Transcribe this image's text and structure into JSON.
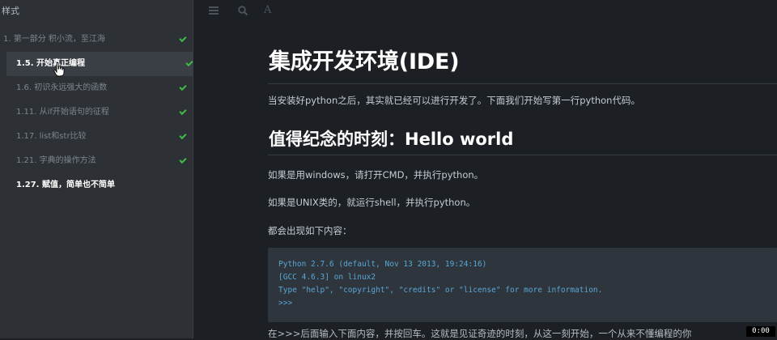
{
  "sidebar": {
    "header": "样式",
    "items": [
      {
        "label": "1. 第一部分 积小流，至江海",
        "checked": true
      },
      {
        "label": "1.5. 开始真正编程",
        "checked": true
      },
      {
        "label": "1.6. 初识永远强大的函数",
        "checked": true
      },
      {
        "label": "1.11. 从if开始语句的征程",
        "checked": true
      },
      {
        "label": "1.17. list和str比较",
        "checked": true
      },
      {
        "label": "1.21. 字典的操作方法",
        "checked": true
      },
      {
        "label": "1.27. 赋值，简单也不简单",
        "checked": false
      }
    ]
  },
  "toolbar": {
    "menu_icon": "menu-icon",
    "search_icon": "search-icon",
    "font_icon": "font-icon",
    "font_glyph": "A"
  },
  "content": {
    "title": "集成开发环境(IDE)",
    "intro": "当安装好python之后，其实就已经可以进行开发了。下面我们开始写第一行python代码。",
    "h2": "值得纪念的时刻：Hello world",
    "p1": "如果是用windows，请打开CMD，并执行python。",
    "p2": "如果是UNIX类的，就运行shell，并执行python。",
    "p3": "都会出现如下内容：",
    "code": [
      "Python 2.7.6 (default, Nov 13 2013, 19:24:16)",
      "[GCC 4.6.3] on linux2",
      "Type \"help\", \"copyright\", \"credits\" or \"license\" for more information.",
      ">>>"
    ],
    "bottom": "在>>>后面输入下面内容，并按回车。这就是见证奇迹的时刻，从这一刻开始，一个从来不懂编程的你"
  },
  "overlay": {
    "timer": "0:00"
  },
  "colors": {
    "check": "#3dbd41",
    "code_text": "#58a7d6",
    "sidebar_bg": "#2d3136",
    "content_bg": "#1c1f24"
  }
}
